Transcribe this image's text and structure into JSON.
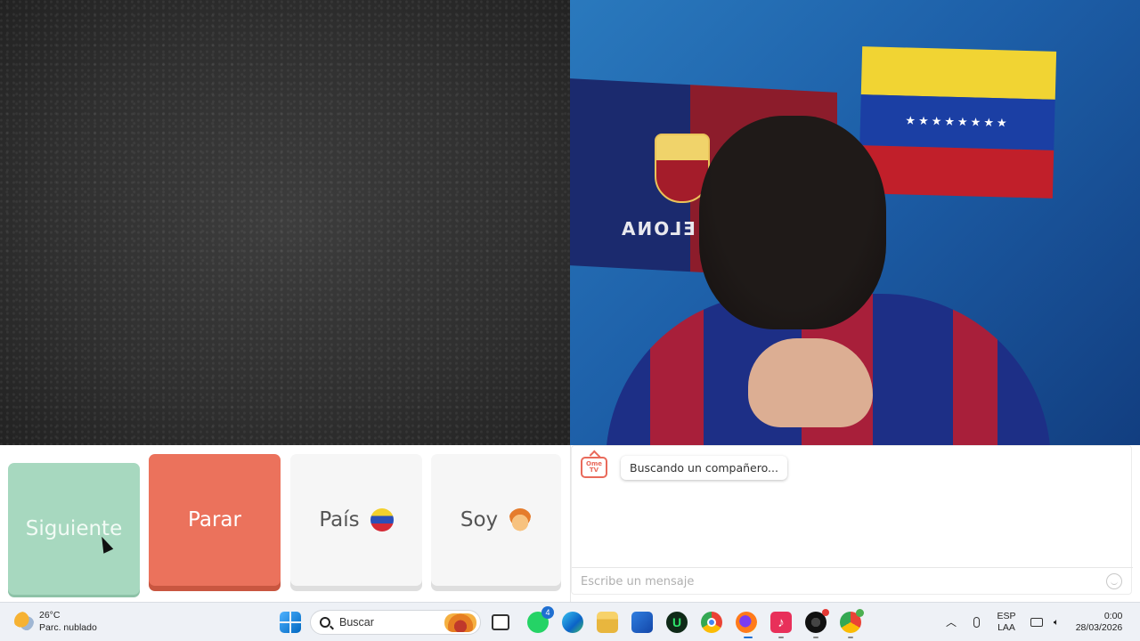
{
  "controls": {
    "next_label": "Siguiente",
    "stop_label": "Parar",
    "country_label": "País",
    "gender_label": "Soy"
  },
  "chat": {
    "logo_text": "Ome TV",
    "status_message": "Buscando un compañero...",
    "input_placeholder": "Escribe un mensaje"
  },
  "remote_video": {
    "flag_text": "ELONA"
  },
  "taskbar": {
    "weather_temp": "26°C",
    "weather_desc": "Parc. nublado",
    "search_placeholder": "Buscar",
    "whatsapp_badge": "4",
    "lang_line1": "ESP",
    "lang_line2": "LAA",
    "time": "0:00",
    "date": "28/03/2026"
  },
  "colors": {
    "next": "#a7d8bf",
    "stop": "#eb725c",
    "neutral": "#f6f6f6"
  }
}
